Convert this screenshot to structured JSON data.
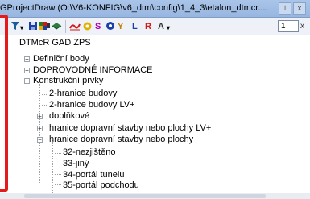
{
  "window": {
    "title": "GProjectDraw  (O:\\V6-KONFIG\\v6_dtm\\config\\1_4_3\\etalon_dtmcr....",
    "pin_glyph": "⊥",
    "close_glyph": "x"
  },
  "toolbar": {
    "tool_s": "S",
    "tool_y": "Y",
    "tool_l": "L",
    "tool_r": "R",
    "tool_a": "A",
    "tool_a_arrow": "▾",
    "page_value": "1",
    "close_glyph": "x",
    "colors": {
      "blue": "#1b3ea8",
      "red": "#d01818",
      "magenta": "#b000b0",
      "yellow": "#e0b000",
      "green": "#208020"
    }
  },
  "tree": {
    "root": "DTMcR GAD ZPS",
    "items": [
      {
        "label": "Definiční body",
        "expander": "+"
      },
      {
        "label": "DOPROVODNÉ INFORMACE",
        "expander": "+"
      },
      {
        "label": "Konstrukční prvky",
        "expander": "−"
      },
      {
        "label": "2-hranice budovy",
        "expander": ""
      },
      {
        "label": "2-hranice budovy LV+",
        "expander": ""
      },
      {
        "label": "doplňkové",
        "expander": "+"
      },
      {
        "label": "hranice dopravní stavby nebo plochy LV+",
        "expander": "+"
      },
      {
        "label": "hranice dopravní stavby nebo plochy",
        "expander": "−"
      },
      {
        "label": "32-nezjištěno",
        "expander": ""
      },
      {
        "label": "33-jiný",
        "expander": ""
      },
      {
        "label": "34-portál tunelu",
        "expander": ""
      },
      {
        "label": "35-portál podchodu",
        "expander": ""
      }
    ]
  }
}
